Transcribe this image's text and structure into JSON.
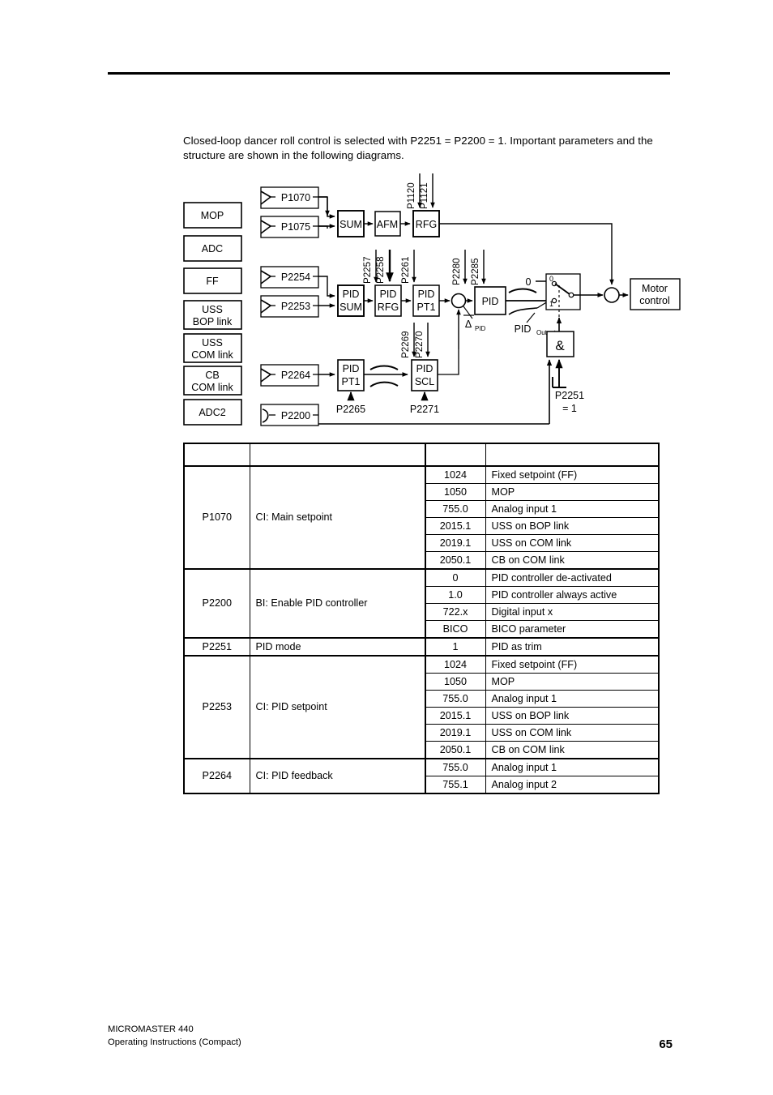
{
  "intro": {
    "line1": "Closed-loop dancer roll control is selected with P2251 = P2200 = 1. Important parameters",
    "line2": "and the structure are shown in the following diagrams."
  },
  "diagram": {
    "sources": [
      {
        "label": "MOP"
      },
      {
        "label": "ADC"
      },
      {
        "label": "FF"
      },
      {
        "label_line1": "USS",
        "label_line2": "BOP link"
      },
      {
        "label_line1": "USS",
        "label_line2": "COM link"
      },
      {
        "label_line1": "CB",
        "label_line2": "COM link"
      },
      {
        "label": "ADC2"
      }
    ],
    "connectors": [
      {
        "label": "P1070"
      },
      {
        "label": "P1075"
      },
      {
        "label": "P2254"
      },
      {
        "label": "P2253"
      },
      {
        "label": "P2264"
      },
      {
        "label": "P2200"
      }
    ],
    "blocks": {
      "sum": "SUM",
      "afm": "AFM",
      "rfg": "RFG",
      "pid_sum_l1": "PID",
      "pid_sum_l2": "SUM",
      "pid_rfg_l1": "PID",
      "pid_rfg_l2": "RFG",
      "pid_pt1_l1": "PID",
      "pid_pt1_l2": "PT1",
      "pid": "PID",
      "pid_pt1b_l1": "PID",
      "pid_pt1b_l2": "PT1",
      "pid_scl_l1": "PID",
      "pid_scl_l2": "SCL",
      "and_gate": "&",
      "motor_l1": "Motor",
      "motor_l2": "control"
    },
    "param_arrows": {
      "p1120": "P1120",
      "p1121": "P1121",
      "p2257": "P2257",
      "p2258": "P2258",
      "p2261": "P2261",
      "p2280": "P2280",
      "p2285": "P2285",
      "p2269": "P2269",
      "p2270": "P2270",
      "p2265": "P2265",
      "p2271": "P2271"
    },
    "labels": {
      "delta_pid_main": "Δ",
      "delta_pid_sub": "PID",
      "pid_output_main": "PID",
      "pid_output_sub": "Output",
      "switch_zero_left": "0",
      "switch_pos_0": "0",
      "switch_pos_1": "1",
      "p2251": "P2251",
      "p2251_value": "= 1"
    }
  },
  "table": {
    "header": {
      "col1": "",
      "col2": "",
      "col3": "",
      "col4": ""
    },
    "rows": [
      {
        "param": "P1070",
        "desc": "CI: Main setpoint",
        "span": 6,
        "values": [
          {
            "value": "1024",
            "meaning": "Fixed setpoint (FF)"
          },
          {
            "value": "1050",
            "meaning": "MOP"
          },
          {
            "value": "755.0",
            "meaning": "Analog input 1"
          },
          {
            "value": "2015.1",
            "meaning": "USS on BOP link"
          },
          {
            "value": "2019.1",
            "meaning": "USS on COM link"
          },
          {
            "value": "2050.1",
            "meaning": "CB on COM link"
          }
        ]
      },
      {
        "param": "P2200",
        "desc": "BI: Enable PID controller",
        "span": 4,
        "values": [
          {
            "value": "0",
            "meaning": "PID controller de-activated"
          },
          {
            "value": "1.0",
            "meaning": "PID controller always active"
          },
          {
            "value": "722.x",
            "meaning": "Digital input x"
          },
          {
            "value": "BICO",
            "meaning": "BICO parameter"
          }
        ]
      },
      {
        "param": "P2251",
        "desc": "PID mode",
        "span": 1,
        "values": [
          {
            "value": "1",
            "meaning": "PID as trim"
          }
        ]
      },
      {
        "param": "P2253",
        "desc": "CI: PID setpoint",
        "span": 6,
        "values": [
          {
            "value": "1024",
            "meaning": "Fixed setpoint (FF)"
          },
          {
            "value": "1050",
            "meaning": "MOP"
          },
          {
            "value": "755.0",
            "meaning": "Analog input 1"
          },
          {
            "value": "2015.1",
            "meaning": "USS on BOP link"
          },
          {
            "value": "2019.1",
            "meaning": "USS on COM link"
          },
          {
            "value": "2050.1",
            "meaning": "CB on COM link"
          }
        ]
      },
      {
        "param": "P2264",
        "desc": "CI: PID feedback",
        "span": 2,
        "values": [
          {
            "value": "755.0",
            "meaning": "Analog input 1"
          },
          {
            "value": "755.1",
            "meaning": "Analog input 2"
          }
        ]
      }
    ]
  },
  "footer": {
    "product": "MICROMASTER 440",
    "doc": "Operating Instructions (Compact)",
    "page": "65"
  }
}
